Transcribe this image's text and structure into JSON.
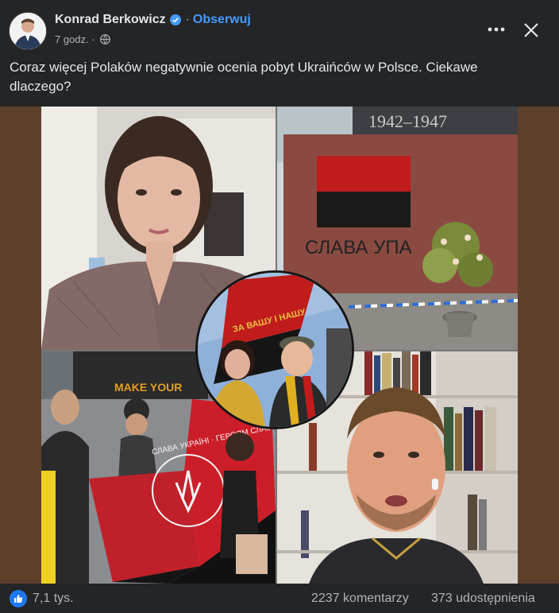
{
  "post": {
    "author": "Konrad Berkowicz",
    "follow_label": "Obserwuj",
    "separator": "·",
    "timestamp": "7 godz. ·",
    "caption": "Coraz więcej Polaków negatywnie ocenia pobyt Ukraińców w Polsce. Ciekawe dlaczego?"
  },
  "image": {
    "memorial_years": "1942–1947",
    "graffiti": "СЛАВА УПА",
    "rally_flag_text": "СЛАВА УКРАЇНІ · ГЕРОЯМ СЛАВА!",
    "badge_text": "MAKE YOUR",
    "circle_flag_text": "ЗА ВАШУ І НАШУ"
  },
  "stats": {
    "likes": "7,1 tys.",
    "comments": "2237 komentarzy",
    "shares": "373 udostępnienia"
  },
  "icons": {
    "verified": "verified-badge-icon",
    "globe": "globe-icon",
    "more": "more-options-icon",
    "close": "close-icon",
    "like": "like-thumb-icon"
  },
  "colors": {
    "background": "#242526",
    "text": "#e4e6eb",
    "secondary_text": "#b0b3b8",
    "accent": "#4599ff",
    "like_blue": "#2078f4",
    "media_frame": "#5e402b"
  }
}
